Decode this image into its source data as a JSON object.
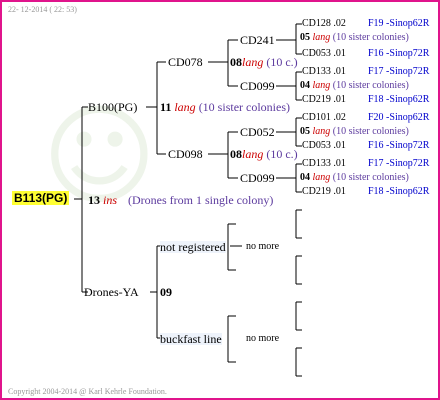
{
  "header": {
    "timestamp": "22- 12-2014 ( 22: 53)"
  },
  "footer": {
    "copyright": "Copyright 2004-2014 @ Karl Kehrle Foundation."
  },
  "root": {
    "id": "B113(PG)",
    "number": "13",
    "ins": "ins",
    "note": "(Drones from 1 single colony)"
  },
  "queen": {
    "label": "B100(PG)",
    "number": "11",
    "lang": "lang",
    "note": "(10 sister colonies)"
  },
  "drones": {
    "label": "Drones-YA",
    "number": "09"
  },
  "gen2": [
    {
      "label": "CD078",
      "number": "08",
      "lang": "lang",
      "note": "(10 c.)"
    },
    {
      "label": "CD098",
      "number": "08",
      "lang": "lang",
      "note": "(10 c.)"
    }
  ],
  "gen3": [
    {
      "label": "CD241",
      "number": "05",
      "lang": "lang",
      "note": "(10 sister colonies)"
    },
    {
      "label": "CD099",
      "number": "04",
      "lang": "lang",
      "note": "(10 sister colonies)"
    },
    {
      "label": "CD052",
      "number": "05",
      "lang": "lang",
      "note": "(10 sister colonies)"
    },
    {
      "label": "CD099",
      "number": "04",
      "lang": "lang",
      "note": "(10 sister colonies)"
    }
  ],
  "gen4": [
    {
      "id": "CD128",
      "num": ".02",
      "ref": "F19 -Sinop62R"
    },
    {
      "id": "CD053",
      "num": ".01",
      "ref": "F16 -Sinop72R"
    },
    {
      "id": "CD133",
      "num": ".01",
      "ref": "F17 -Sinop72R"
    },
    {
      "id": "CD219",
      "num": ".01",
      "ref": "F18 -Sinop62R"
    },
    {
      "id": "CD101",
      "num": ".02",
      "ref": "F20 -Sinop62R"
    },
    {
      "id": "CD053",
      "num": ".01",
      "ref": "F16 -Sinop72R"
    },
    {
      "id": "CD133",
      "num": ".01",
      "ref": "F17 -Sinop72R"
    },
    {
      "id": "CD219",
      "num": ".01",
      "ref": "F18 -Sinop62R"
    }
  ],
  "drone_branches": [
    {
      "label": "not registered",
      "more": "no more"
    },
    {
      "label": "buckfast line",
      "more": "no more"
    }
  ]
}
